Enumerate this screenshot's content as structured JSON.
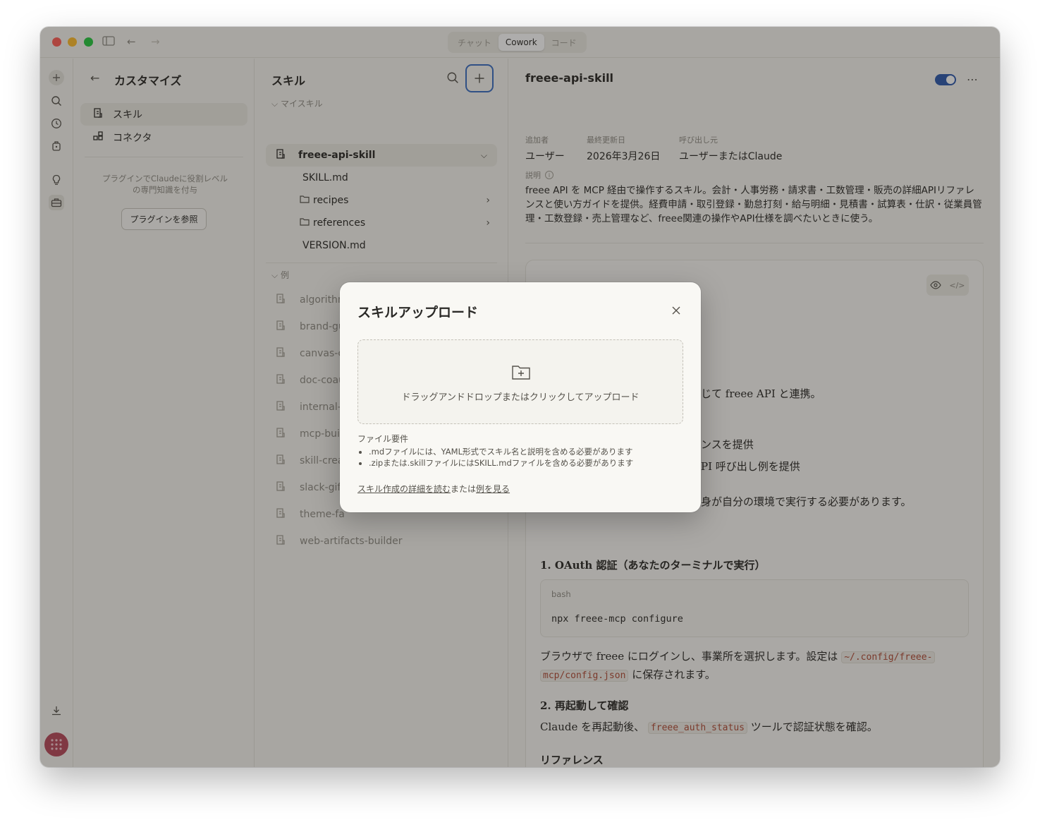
{
  "titlebar": {
    "tabs": [
      {
        "label": "チャット",
        "active": false
      },
      {
        "label": "Cowork",
        "active": true
      },
      {
        "label": "コード",
        "active": false
      }
    ]
  },
  "rail": {
    "icons": [
      "plus-icon",
      "search-icon",
      "clock-icon",
      "briefcase-icon",
      "bulb-icon",
      "toolbox-icon",
      "download-icon"
    ]
  },
  "customize": {
    "title": "カスタマイズ",
    "nav": [
      {
        "label": "スキル",
        "active": true
      },
      {
        "label": "コネクタ",
        "active": false
      }
    ],
    "plugin_text": "プラグインでClaudeに役割レベルの専門知識を付与",
    "plugin_button": "プラグインを参照"
  },
  "skills": {
    "title": "スキル",
    "my_skills_label": "マイスキル",
    "selected_skill": "freee-api-skill",
    "files": [
      {
        "name": "SKILL.md",
        "folder": false
      },
      {
        "name": "recipes",
        "folder": true
      },
      {
        "name": "references",
        "folder": true
      },
      {
        "name": "VERSION.md",
        "folder": false
      }
    ],
    "examples_label": "例",
    "examples": [
      "algorithmic-art",
      "brand-gu",
      "canvas-c",
      "doc-coau",
      "internal-",
      "mcp-buil",
      "skill-crea",
      "slack-gif",
      "theme-fa",
      "web-artifacts-builder"
    ]
  },
  "detail": {
    "title": "freee-api-skill",
    "added_by_label": "追加者",
    "added_by": "ユーザー",
    "updated_label": "最終更新日",
    "updated": "2026年3月26日",
    "invoked_label": "呼び出し元",
    "invoked": "ユーザーまたはClaude",
    "description_label": "説明",
    "description": "freee API を MCP 経由で操作するスキル。会計・人事労務・請求書・工数管理・販売の詳細APIリファレンスと使い方ガイドを提供。経費申請・取引登録・勤怠打刻・給与明細・見積書・試算表・仕訳・従業員管理・工数登録・売上管理など、freee関連の操作やAPI仕様を調べたいときに使う。",
    "doc": {
      "line1": "じて freee API と連携。",
      "line2": "ンスを提供",
      "line3": "PI 呼び出し例を提供",
      "line4": "身が自分の環境で実行する必要があります。",
      "h_oauth": "1. OAuth 認証（あなたのターミナルで実行）",
      "code_lang": "bash",
      "code": "npx freee-mcp configure",
      "p_browser_a": "ブラウザで freee にログインし、事業所を選択します。設定は",
      "code_path_a": "~/.config/freee-",
      "code_path_b": "mcp/config.json",
      "p_browser_b": "に保存されます。",
      "h_restart": "2. 再起動して確認",
      "p_restart_a": "Claude を再起動後、",
      "code_status": "freee_auth_status",
      "p_restart_b": "ツールで認証状態を確認。",
      "h_ref": "リファレンス"
    }
  },
  "modal": {
    "title": "スキルアップロード",
    "drop_text": "ドラッグアンドドロップまたはクリックしてアップロード",
    "req_title": "ファイル要件",
    "req_items": [
      ".mdファイルには、YAML形式でスキル名と説明を含める必要があります",
      ".zipまたは.skillファイルにはSKILL.mdファイルを含める必要があります"
    ],
    "link1": "スキル作成の詳細を読む",
    "middle": "または",
    "link2": "例を見る"
  },
  "colors": {
    "toggle": "#2e5aac",
    "accent_border": "#3b6ec2",
    "avatar": "#b84a5c",
    "code_text": "#b04c37"
  }
}
